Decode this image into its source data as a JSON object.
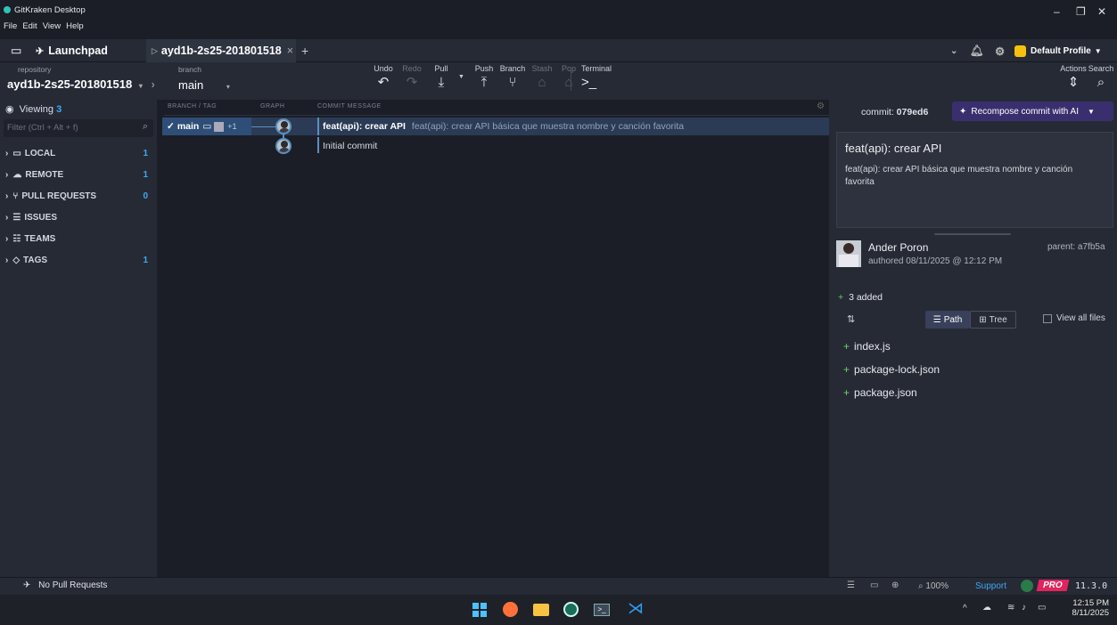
{
  "app": {
    "title": "GitKraken Desktop",
    "menu": [
      "File",
      "Edit",
      "View",
      "Help"
    ]
  },
  "tabs": {
    "launchpad": "Launchpad",
    "repo_tab": "ayd1b-2s25-201801518",
    "add": "+",
    "profile": "Default Profile"
  },
  "toolbar": {
    "repo_label": "repository",
    "repo_name": "ayd1b-2s25-201801518",
    "branch_label": "branch",
    "branch_name": "main",
    "undo": "Undo",
    "redo": "Redo",
    "pull": "Pull",
    "push": "Push",
    "branch": "Branch",
    "stash": "Stash",
    "pop": "Pop",
    "terminal": "Terminal",
    "actions": "Actions",
    "search": "Search"
  },
  "sidebar": {
    "viewing_label": "Viewing",
    "viewing_count": "3",
    "filter_placeholder": "Filter (Ctrl + Alt + f)",
    "sections": [
      {
        "label": "LOCAL",
        "count": "1"
      },
      {
        "label": "REMOTE",
        "count": "1"
      },
      {
        "label": "PULL REQUESTS",
        "count": "0"
      },
      {
        "label": "ISSUES",
        "count": ""
      },
      {
        "label": "TEAMS",
        "count": ""
      },
      {
        "label": "TAGS",
        "count": "1"
      }
    ]
  },
  "graph": {
    "headers": {
      "branch": "BRANCH / TAG",
      "graph": "GRAPH",
      "message": "COMMIT MESSAGE"
    },
    "branch_ref": {
      "name": "main",
      "extra": "+1"
    },
    "commits": [
      {
        "summary": "feat(api): crear API",
        "description": "feat(api): crear API básica que muestra nombre y canción favorita"
      },
      {
        "summary": "Initial commit",
        "description": ""
      }
    ]
  },
  "details": {
    "commit_label": "commit:",
    "commit_sha": "079ed6",
    "recompose": "Recompose commit with AI",
    "title": "feat(api): crear API",
    "body": "feat(api): crear API básica que muestra nombre y canción favorita",
    "author": "Ander Poron",
    "authored": "authored 08/11/2025 @ 12:12 PM",
    "parent_label": "parent:",
    "parent_sha": "a7fb5a",
    "added": "3 added",
    "path_btn": "Path",
    "tree_btn": "Tree",
    "view_all": "View all files",
    "files": [
      "index.js",
      "package-lock.json",
      "package.json"
    ]
  },
  "status": {
    "no_prs": "No Pull Requests",
    "zoom": "100%",
    "support": "Support",
    "pro": "PRO",
    "version": "11.3.0"
  },
  "taskbar": {
    "time": "12:15 PM",
    "date": "8/11/2025"
  },
  "colors": {
    "accent": "#3fa9f5",
    "selected_row": "#2b3b55",
    "green": "#6cd16c",
    "pro": "#e0245e",
    "recompose": "#3a2f6e"
  }
}
